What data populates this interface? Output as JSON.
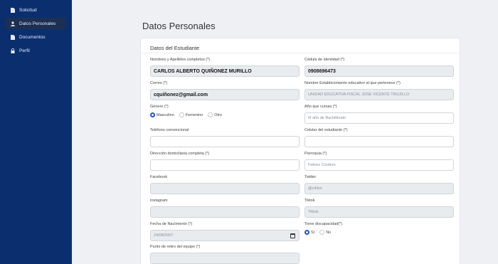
{
  "sidebar": {
    "items": [
      {
        "label": "Solicitud",
        "icon": "document-icon"
      },
      {
        "label": "Datos Personales",
        "icon": "user-icon"
      },
      {
        "label": "Documentos",
        "icon": "document-icon"
      },
      {
        "label": "Perfil",
        "icon": "lock-icon"
      }
    ],
    "active_index": 1
  },
  "page_title": "Datos Personales",
  "card_title": "Datos del Estudiante",
  "fields": {
    "nombres": {
      "label": "Nombres y Apellidos completos (*)",
      "value": "CARLOS ALBERTO QUIÑONEZ MURILLO"
    },
    "cedula": {
      "label": "Cédula de identidad (*)",
      "value": "0908696473"
    },
    "correo": {
      "label": "Correo (*)",
      "value": "cquiñonez@gmail.com"
    },
    "establecimiento": {
      "label": "Nombre Establecimiento educativo al que pertenece (*)",
      "value": "UNIDAD EDUCATIVA FISCAL JOSE VICENTE TRUJILLO"
    },
    "genero": {
      "label": "Género (*)",
      "options": [
        "Masculino",
        "Femenino",
        "Otro"
      ],
      "selected": "Masculino"
    },
    "anio": {
      "label": "Año que cursas (*)",
      "value": "III año de Bachillerato"
    },
    "telefono": {
      "label": "Teléfono convencional",
      "value": ""
    },
    "celular": {
      "label": "Celular del estudiante (*)",
      "value": ""
    },
    "direccion": {
      "label": "Dirección domiciliaria completa (*)",
      "value": ""
    },
    "parroquia": {
      "label": "Parroquia (*)",
      "value": "Febres Cordero"
    },
    "facebook": {
      "label": "Facebook",
      "value": ""
    },
    "twitter": {
      "label": "Twitter",
      "value": "@crlilvo"
    },
    "instagram": {
      "label": "Instagram",
      "value": ""
    },
    "tiktok": {
      "label": "Tiktok",
      "value": "Tiktok"
    },
    "nacimiento": {
      "label": "Fecha de Nacimiento (*)",
      "value": "24/08/2007"
    },
    "discapacidad": {
      "label": "Tiene discapacidad(*)",
      "options": [
        "Sí",
        "No"
      ],
      "selected": "Sí"
    },
    "retiro": {
      "label": "Punto de retiro del equipo (*)",
      "value": ""
    }
  },
  "colors": {
    "sidebar_bg": "#0b2f6e",
    "accent": "#1a56db",
    "page_bg": "#eef0f4"
  }
}
